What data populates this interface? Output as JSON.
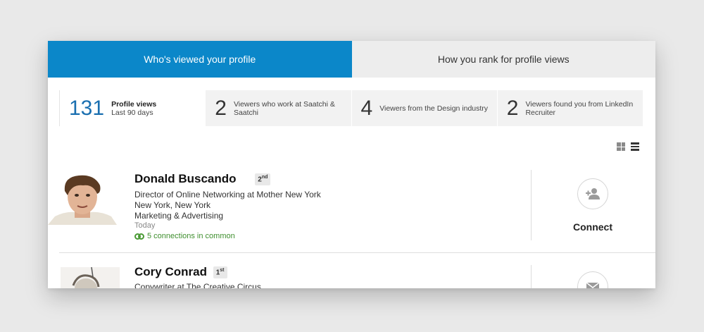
{
  "tabs": [
    {
      "label": "Who's viewed your profile"
    },
    {
      "label": "How you rank for profile views"
    }
  ],
  "stats": [
    {
      "number": "131",
      "label": "Profile views",
      "sublabel": "Last 90 days"
    },
    {
      "number": "2",
      "label": "Viewers who work at Saatchi & Saatchi"
    },
    {
      "number": "4",
      "label": "Viewers from the Design industry"
    },
    {
      "number": "2",
      "label": "Viewers found you from LinkedIn Recruiter"
    }
  ],
  "viewers": [
    {
      "name": "Donald Buscando",
      "degree": "2",
      "degree_suffix": "nd",
      "title": "Director of Online Networking at Mother New York",
      "location": "New York, New York",
      "industry": "Marketing & Advertising",
      "time": "Today",
      "common": "5 connections in common",
      "action": "Connect"
    },
    {
      "name": "Cory Conrad",
      "degree": "1",
      "degree_suffix": "st",
      "title": "Copywriter at The Creative Circus"
    }
  ],
  "colors": {
    "accent": "#0b87c9",
    "stat_accent": "#1a6fb0",
    "common_green": "#3f8f2e"
  },
  "icons": [
    "grid-view-icon",
    "list-view-icon",
    "add-connection-icon",
    "message-icon",
    "connections-in-common-icon"
  ]
}
